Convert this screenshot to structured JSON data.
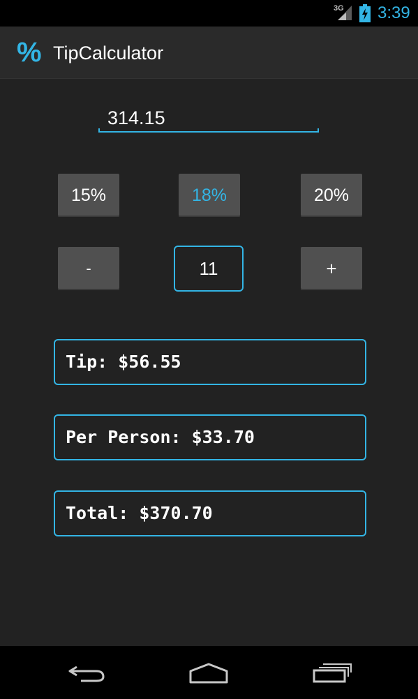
{
  "status_bar": {
    "network": "3G",
    "time": "3:39",
    "icons": [
      "signal-icon",
      "battery-charging-icon"
    ]
  },
  "action_bar": {
    "icon": "%",
    "title": "TipCalculator"
  },
  "bill": {
    "value": "314.15"
  },
  "tip_buttons": [
    {
      "label": "15%",
      "selected": false
    },
    {
      "label": "18%",
      "selected": true
    },
    {
      "label": "20%",
      "selected": false
    }
  ],
  "people": {
    "minus_label": "-",
    "count": "11",
    "plus_label": "+"
  },
  "results": {
    "tip": "Tip: $56.55",
    "per_person": "Per Person: $33.70",
    "total": "Total: $370.70"
  },
  "nav_bar": {
    "icons": [
      "back-icon",
      "home-icon",
      "recent-apps-icon"
    ]
  },
  "colors": {
    "accent": "#33b5e5",
    "background": "#222222",
    "button": "#505050"
  }
}
